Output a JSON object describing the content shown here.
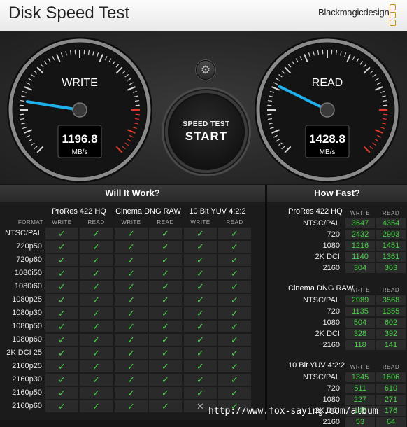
{
  "app": {
    "title": "Disk Speed Test",
    "brand": "Blackmagicdesign"
  },
  "gauges": {
    "write": {
      "label": "WRITE",
      "value": "1196.8",
      "unit": "MB/s"
    },
    "read": {
      "label": "READ",
      "value": "1428.8",
      "unit": "MB/s"
    }
  },
  "start_button": {
    "line1": "SPEED TEST",
    "line2": "START"
  },
  "will_it_work": {
    "title": "Will It Work?",
    "format_header": "FORMAT",
    "write_header": "WRITE",
    "read_header": "READ",
    "groups": [
      "ProRes 422 HQ",
      "Cinema DNG RAW",
      "10 Bit YUV 4:2:2"
    ],
    "rows": [
      {
        "label": "NTSC/PAL",
        "checks": [
          true,
          true,
          true,
          true,
          true,
          true
        ]
      },
      {
        "label": "720p50",
        "checks": [
          true,
          true,
          true,
          true,
          true,
          true
        ]
      },
      {
        "label": "720p60",
        "checks": [
          true,
          true,
          true,
          true,
          true,
          true
        ]
      },
      {
        "label": "1080i50",
        "checks": [
          true,
          true,
          true,
          true,
          true,
          true
        ]
      },
      {
        "label": "1080i60",
        "checks": [
          true,
          true,
          true,
          true,
          true,
          true
        ]
      },
      {
        "label": "1080p25",
        "checks": [
          true,
          true,
          true,
          true,
          true,
          true
        ]
      },
      {
        "label": "1080p30",
        "checks": [
          true,
          true,
          true,
          true,
          true,
          true
        ]
      },
      {
        "label": "1080p50",
        "checks": [
          true,
          true,
          true,
          true,
          true,
          true
        ]
      },
      {
        "label": "1080p60",
        "checks": [
          true,
          true,
          true,
          true,
          true,
          true
        ]
      },
      {
        "label": "2K DCI 25",
        "checks": [
          true,
          true,
          true,
          true,
          true,
          true
        ]
      },
      {
        "label": "2160p25",
        "checks": [
          true,
          true,
          true,
          true,
          true,
          true
        ]
      },
      {
        "label": "2160p30",
        "checks": [
          true,
          true,
          true,
          true,
          true,
          true
        ]
      },
      {
        "label": "2160p50",
        "checks": [
          true,
          true,
          true,
          true,
          true,
          true
        ]
      },
      {
        "label": "2160p60",
        "checks": [
          true,
          true,
          true,
          true,
          false,
          true
        ]
      }
    ]
  },
  "how_fast": {
    "title": "How Fast?",
    "write_header": "WRITE",
    "read_header": "READ",
    "groups": [
      {
        "name": "ProRes 422 HQ",
        "rows": [
          {
            "label": "NTSC/PAL",
            "write": "3647",
            "read": "4354"
          },
          {
            "label": "720",
            "write": "2432",
            "read": "2903"
          },
          {
            "label": "1080",
            "write": "1216",
            "read": "1451"
          },
          {
            "label": "2K DCI",
            "write": "1140",
            "read": "1361"
          },
          {
            "label": "2160",
            "write": "304",
            "read": "363"
          }
        ]
      },
      {
        "name": "Cinema DNG RAW",
        "rows": [
          {
            "label": "NTSC/PAL",
            "write": "2989",
            "read": "3568"
          },
          {
            "label": "720",
            "write": "1135",
            "read": "1355"
          },
          {
            "label": "1080",
            "write": "504",
            "read": "602"
          },
          {
            "label": "2K DCI",
            "write": "328",
            "read": "392"
          },
          {
            "label": "2160",
            "write": "118",
            "read": "141"
          }
        ]
      },
      {
        "name": "10 Bit YUV 4:2:2",
        "rows": [
          {
            "label": "NTSC/PAL",
            "write": "1345",
            "read": "1606"
          },
          {
            "label": "720",
            "write": "511",
            "read": "610"
          },
          {
            "label": "1080",
            "write": "227",
            "read": "271"
          },
          {
            "label": "2K DCI",
            "write": "148",
            "read": "176"
          },
          {
            "label": "2160",
            "write": "53",
            "read": "64"
          }
        ]
      }
    ]
  },
  "watermark": "http://www.fox-saying.com/album",
  "colors": {
    "needle": "#1fb0ee",
    "pass": "#46d446",
    "redline": "#e23a2a"
  }
}
